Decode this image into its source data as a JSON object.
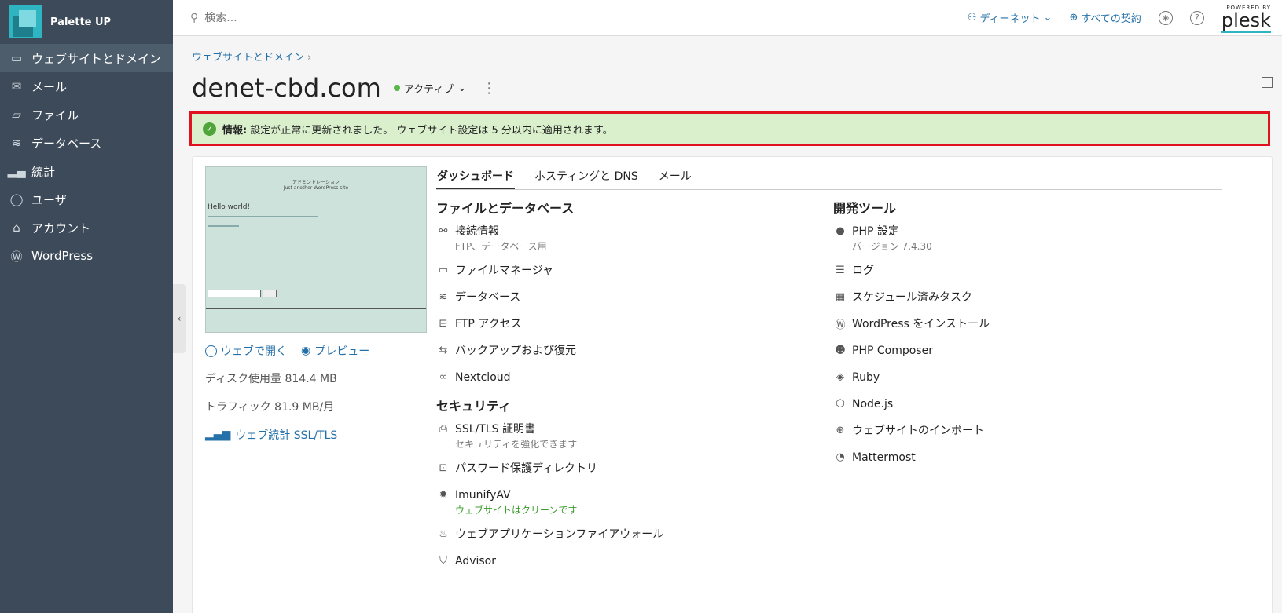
{
  "sidebar": {
    "brand": "Palette UP",
    "items": [
      {
        "label": "ウェブサイトとドメイン",
        "icon": "monitor-icon"
      },
      {
        "label": "メール",
        "icon": "mail-icon"
      },
      {
        "label": "ファイル",
        "icon": "folder-icon"
      },
      {
        "label": "データベース",
        "icon": "database-icon"
      },
      {
        "label": "統計",
        "icon": "bar-chart-icon"
      },
      {
        "label": "ユーザ",
        "icon": "user-icon"
      },
      {
        "label": "アカウント",
        "icon": "account-icon"
      },
      {
        "label": "WordPress",
        "icon": "wordpress-icon"
      }
    ]
  },
  "topbar": {
    "search_placeholder": "検索...",
    "user_label": "ディーネット",
    "subscriptions_label": "すべての契約",
    "powered_by": "POWERED BY",
    "plesk": "plesk"
  },
  "main": {
    "breadcrumb": "ウェブサイトとドメイン",
    "domain": "denet-cbd.com",
    "status": "アクティブ",
    "alert": {
      "label": "情報:",
      "text": "設定が正常に更新されました。 ウェブサイト設定は 5 分以内に適用されます。"
    },
    "preview": {
      "site_title": "アドミントレーション",
      "tagline": "Just another WordPress site",
      "hello": "Hello world!"
    },
    "left": {
      "open_web": "ウェブで開く",
      "preview": "プレビュー",
      "disk": "ディスク使用量 814.4 MB",
      "traffic": "トラフィック 81.9 MB/月",
      "stats": "ウェブ統計 SSL/TLS"
    },
    "tabs": [
      "ダッシュボード",
      "ホスティングと DNS",
      "メール"
    ],
    "col1": {
      "title": "ファイルとデータベース",
      "items": [
        {
          "label": "接続情報",
          "sub": "FTP、データベース用"
        },
        {
          "label": "ファイルマネージャ"
        },
        {
          "label": "データベース"
        },
        {
          "label": "FTP アクセス"
        },
        {
          "label": "バックアップおよび復元"
        },
        {
          "label": "Nextcloud"
        }
      ],
      "security_title": "セキュリティ",
      "security": [
        {
          "label": "SSL/TLS 証明書",
          "sub": "セキュリティを強化できます"
        },
        {
          "label": "パスワード保護ディレクトリ"
        },
        {
          "label": "ImunifyAV",
          "sub": "ウェブサイトはクリーンです"
        },
        {
          "label": "ウェブアプリケーションファイアウォール"
        },
        {
          "label": "Advisor"
        }
      ]
    },
    "col2": {
      "title": "開発ツール",
      "items": [
        {
          "label": "PHP 設定",
          "sub": "バージョン 7.4.30"
        },
        {
          "label": "ログ"
        },
        {
          "label": "スケジュール済みタスク"
        },
        {
          "label": "WordPress をインストール"
        },
        {
          "label": "PHP Composer"
        },
        {
          "label": "Ruby"
        },
        {
          "label": "Node.js"
        },
        {
          "label": "ウェブサイトのインポート"
        },
        {
          "label": "Mattermost"
        }
      ]
    }
  }
}
